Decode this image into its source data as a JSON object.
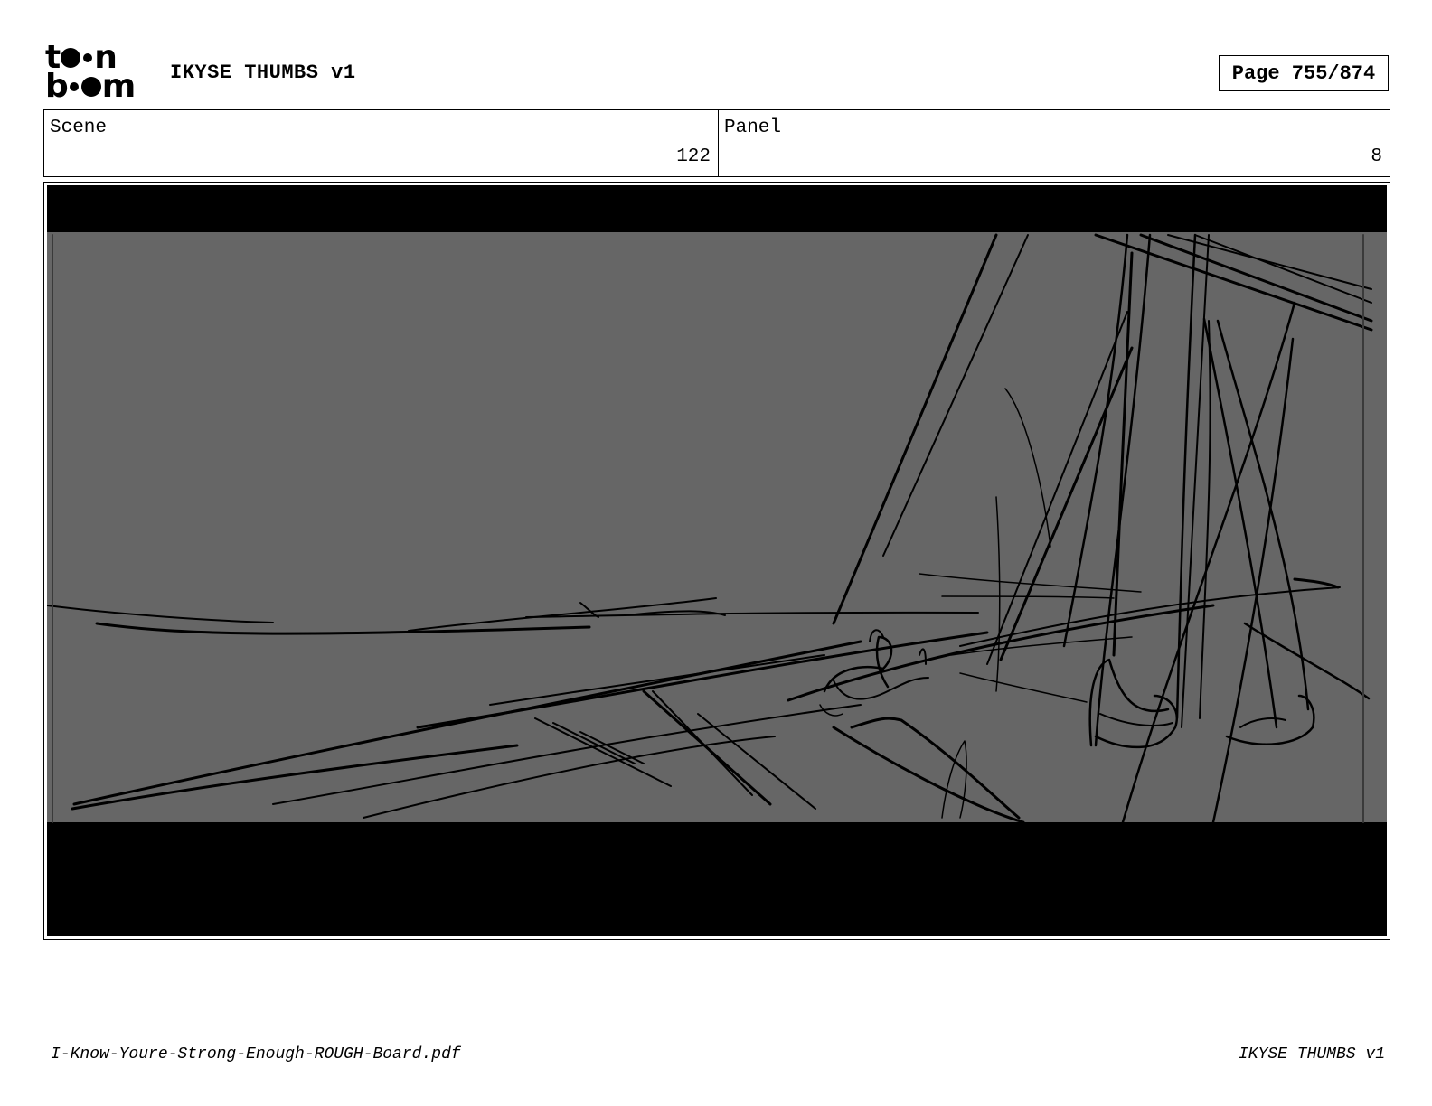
{
  "header": {
    "logo": {
      "line1_start": "t",
      "line1_end": "n",
      "line2_start": "b",
      "line2_end": "m",
      "brand": "toon boom"
    },
    "title": "IKYSE THUMBS v1",
    "page": "Page 755/874"
  },
  "info": {
    "scene_label": "Scene",
    "scene_value": "122",
    "panel_label": "Panel",
    "panel_value": "8"
  },
  "panel_image": {
    "background_color": "#666666",
    "letterbox_color": "#000000",
    "line_color": "#000000"
  },
  "footer": {
    "filename": "I-Know-Youre-Strong-Enough-ROUGH-Board.pdf",
    "project": "IKYSE THUMBS v1"
  }
}
